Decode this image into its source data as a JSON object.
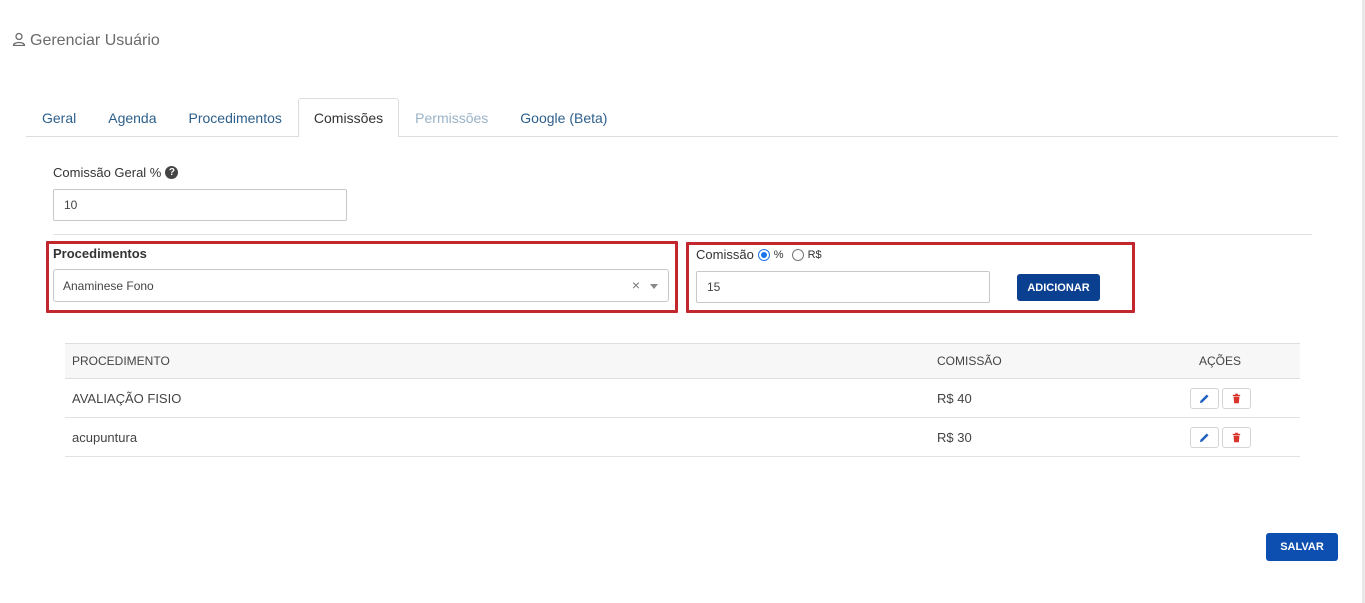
{
  "header": {
    "title": "Gerenciar Usuário",
    "icon": "user-icon"
  },
  "tabs": [
    {
      "label": "Geral",
      "state": "normal"
    },
    {
      "label": "Agenda",
      "state": "normal"
    },
    {
      "label": "Procedimentos",
      "state": "normal"
    },
    {
      "label": "Comissões",
      "state": "active"
    },
    {
      "label": "Permissões",
      "state": "disabled"
    },
    {
      "label": "Google (Beta)",
      "state": "normal"
    }
  ],
  "general_commission": {
    "label": "Comissão Geral %",
    "value": "10"
  },
  "procedures": {
    "label": "Procedimentos",
    "selected": "Anaminese Fono",
    "clear_symbol": "×"
  },
  "commission": {
    "label": "Comissão",
    "options": [
      {
        "label": "%",
        "checked": true
      },
      {
        "label": "R$",
        "checked": false
      }
    ],
    "value": "15",
    "add_button": "ADICIONAR"
  },
  "table": {
    "headers": [
      "PROCEDIMENTO",
      "COMISSÃO",
      "AÇÕES"
    ],
    "rows": [
      {
        "procedure": "AVALIAÇÃO FISIO",
        "commission": "R$ 40"
      },
      {
        "procedure": "acupuntura",
        "commission": "R$ 30"
      }
    ]
  },
  "save_button": "SALVAR",
  "colors": {
    "primary": "#0b3f8f",
    "highlight": "#c1272d",
    "link": "#2d5f8b",
    "delete": "#d9342b",
    "edit": "#1f5fbf"
  }
}
